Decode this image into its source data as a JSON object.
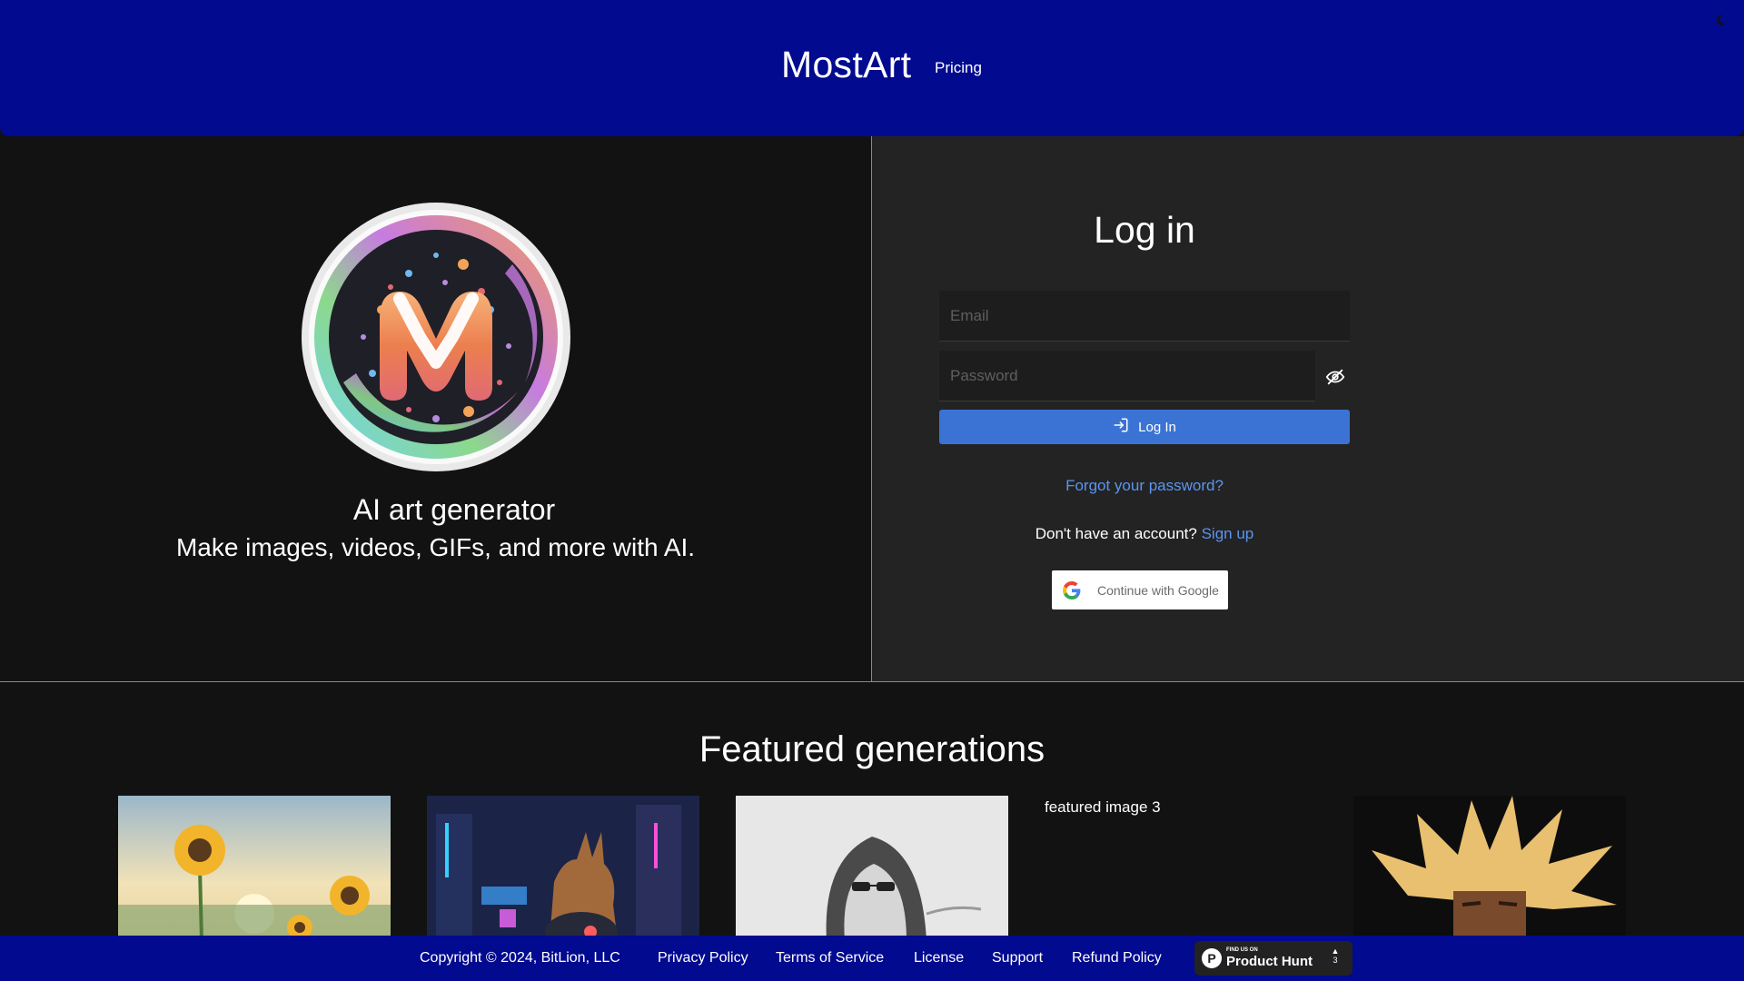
{
  "header": {
    "brand": "MostArt",
    "nav_pricing": "Pricing",
    "theme_icon": "moon-icon"
  },
  "hero": {
    "logo_letter": "M",
    "title": "AI art generator",
    "subtitle": "Make images, videos, GIFs, and more with AI."
  },
  "login": {
    "title": "Log in",
    "email_placeholder": "Email",
    "password_placeholder": "Password",
    "password_toggle_icon": "eye-off-icon",
    "login_button": "Log In",
    "login_button_icon": "login-arrow-icon",
    "forgot": "Forgot your password?",
    "no_account": "Don't have an account?",
    "signup": "Sign up",
    "google_button": "Continue with Google"
  },
  "featured": {
    "title": "Featured generations",
    "broken_image_alt": "featured image 3",
    "images": [
      {
        "subject": "sunflowers-watercolor"
      },
      {
        "subject": "cyber-dog-city"
      },
      {
        "subject": "hooded-figure-sketch"
      },
      {
        "subject": "broken"
      },
      {
        "subject": "spiky-hair-hero"
      }
    ]
  },
  "footer": {
    "copyright": "Copyright © 2024, BitLion, LLC",
    "links": [
      "Privacy Policy",
      "Terms of Service",
      "License",
      "Support",
      "Refund Policy"
    ],
    "product_hunt": {
      "small": "FIND US ON",
      "big": "Product Hunt",
      "logo_letter": "P",
      "votes": "3"
    }
  },
  "colors": {
    "header_bg": "#020a8f",
    "accent_blue": "#3b73d4",
    "link_blue": "#5b95ee",
    "panel_dark": "#121212",
    "panel_login": "#232323"
  }
}
